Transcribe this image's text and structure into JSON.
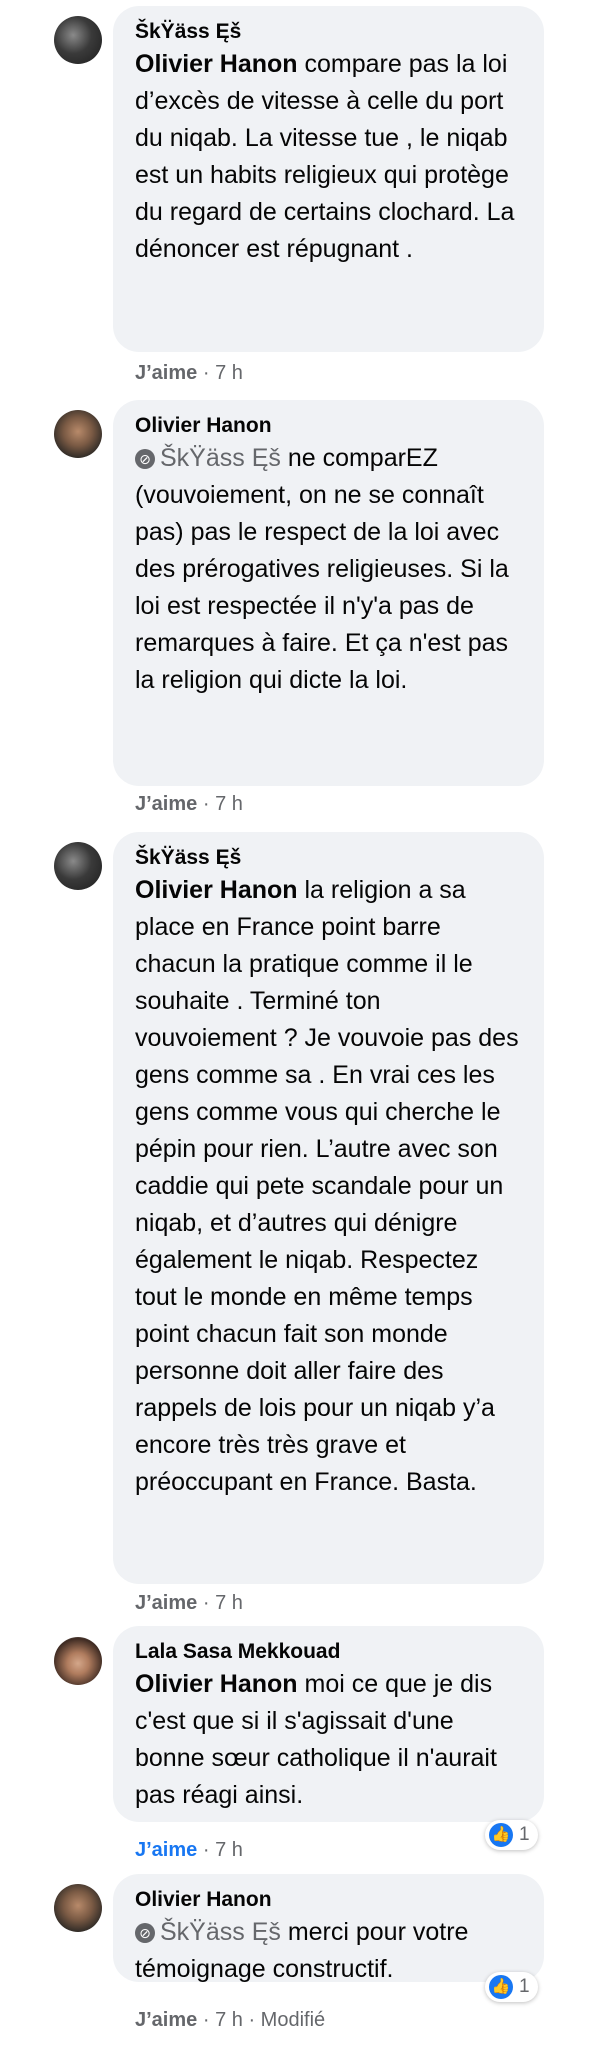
{
  "comments": [
    {
      "author": "ŠkŸäss Ęš",
      "mention": "Olivier Hanon",
      "text": " compare pas la loi d’excès de vitesse à celle du port du niqab. La vitesse tue , le niqab est un habits religieux qui protège du regard de certains clochard. La dénoncer est répugnant .",
      "like": "J’aime",
      "sep": "·",
      "time": "7 h",
      "avatar_icon": "profile-photo-dark"
    },
    {
      "author": "Olivier Hanon",
      "mention": "ŠkŸäss Ęš",
      "text": " ne comparEZ (vouvoiement, on ne se connaît pas) pas le respect de la loi avec des prérogatives religieuses. Si la loi est respectée il n'y'a pas de remarques à faire. Et ça n'est pas la religion qui dicte la loi.",
      "like": "J’aime",
      "sep": "·",
      "time": "7 h",
      "avatar_icon": "profile-photo-man"
    },
    {
      "author": "ŠkŸäss Ęš",
      "mention": "Olivier Hanon",
      "text": " la religion a sa place en France point barre chacun la pratique comme il le souhaite . Terminé ton vouvoiement ? Je vouvoie pas des gens comme sa . En vrai ces les gens comme vous qui cherche le pépin pour rien. L’autre avec son caddie qui pete scandale pour un niqab, et d’autres qui dénigre également le niqab. Respectez tout le monde en même temps point chacun fait son monde personne doit aller faire des rappels de lois pour un niqab y’a encore très très grave et préoccupant en France. Basta.",
      "like": "J’aime",
      "sep": "·",
      "time": "7 h",
      "avatar_icon": "profile-photo-dark"
    },
    {
      "author": "Lala Sasa Mekkouad",
      "mention": "Olivier Hanon",
      "text": " moi ce que je dis c'est que si il s'agissait d'une bonne sœur catholique il n'aurait pas réagi ainsi.",
      "like": "J’aime",
      "sep": "·",
      "time": "7 h",
      "reaction_count": "1",
      "reaction_icon": "like-thumb-icon",
      "avatar_icon": "profile-photo-woman"
    },
    {
      "author": "Olivier Hanon",
      "mention": "ŠkŸäss Ęš",
      "text": " merci pour votre témoignage constructif.",
      "like": "J’aime",
      "sep": "·",
      "time": "7 h",
      "sep2": "·",
      "edited": "Modifié",
      "reaction_count": "1",
      "reaction_icon": "like-thumb-icon",
      "avatar_icon": "profile-photo-man"
    }
  ],
  "colors": {
    "bubble": "#f0f2f5",
    "meta": "#65676b",
    "like_active": "#1877f2"
  }
}
